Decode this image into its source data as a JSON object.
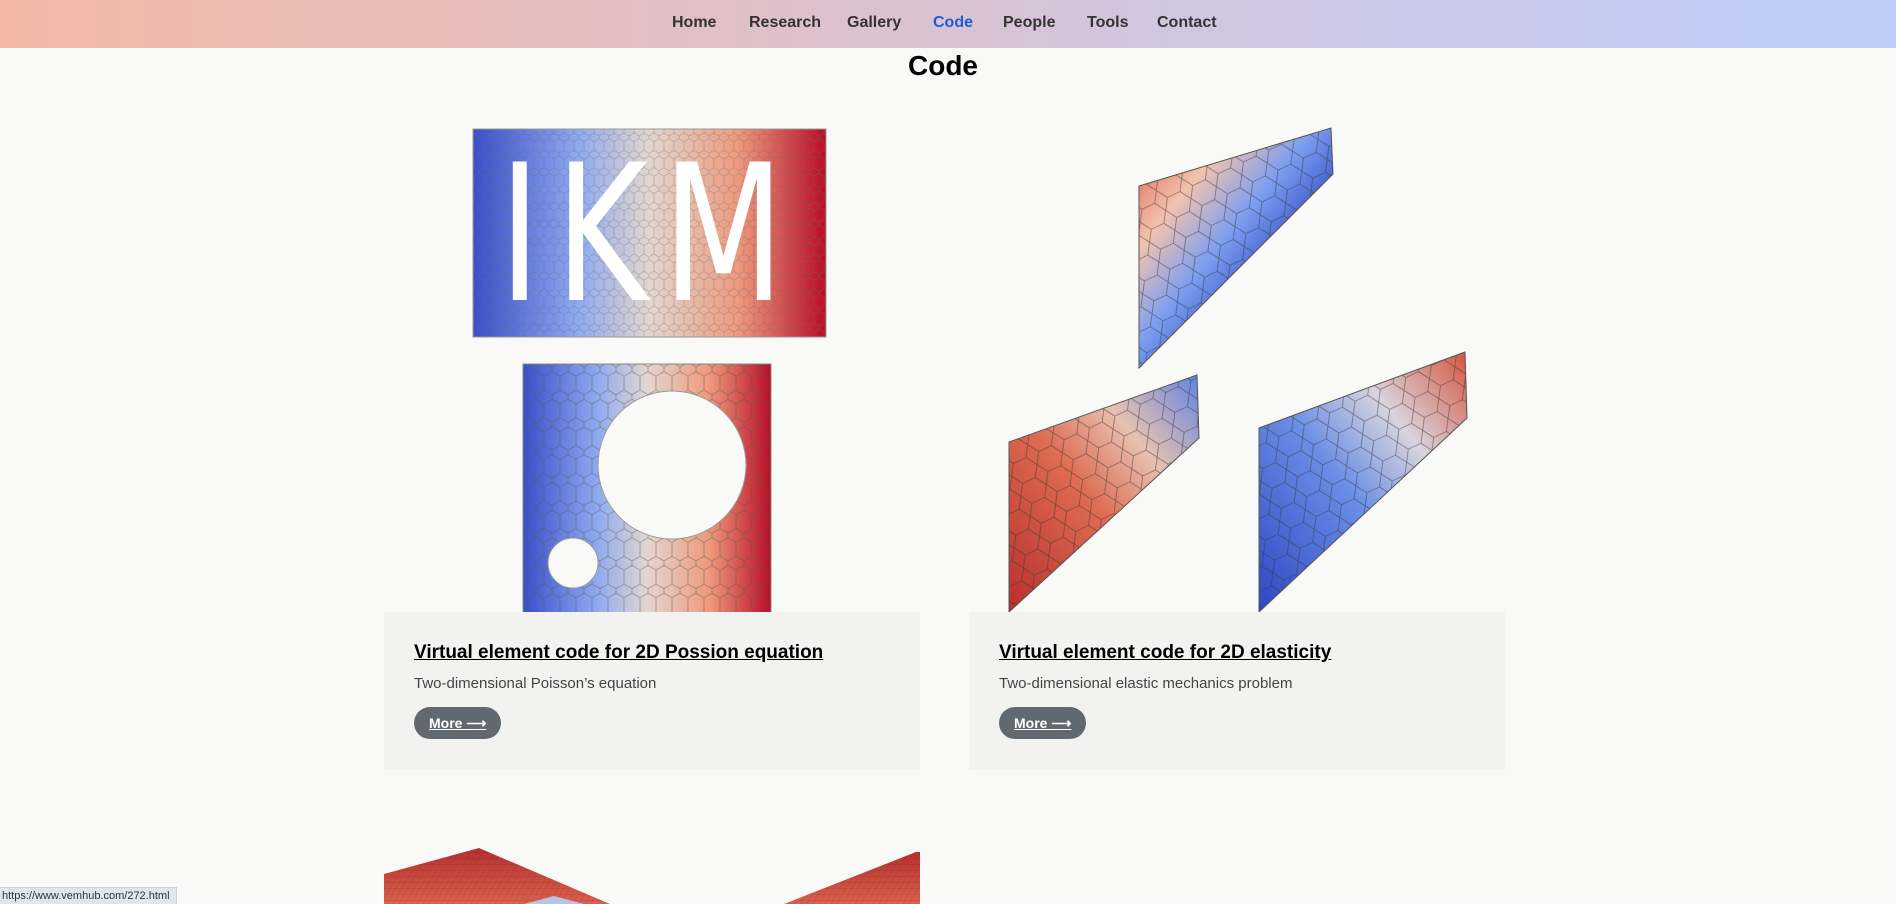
{
  "nav": {
    "items": [
      {
        "label": "Home"
      },
      {
        "label": "Research"
      },
      {
        "label": "Gallery"
      },
      {
        "label": "Code"
      },
      {
        "label": "People"
      },
      {
        "label": "Tools"
      },
      {
        "label": "Contact"
      }
    ],
    "active": "Code"
  },
  "page": {
    "title": "Code"
  },
  "cards": [
    {
      "title": "Virtual element code for 2D Possion equation",
      "description": "Two-dimensional Poisson’s equation",
      "more_label": "More",
      "more_arrow": "⟶",
      "image": {
        "logo_text": "IKM"
      }
    },
    {
      "title": "Virtual element code for 2D elasticity",
      "description": "Two-dimensional elastic mechanics problem",
      "more_label": "More",
      "more_arrow": "⟶"
    }
  ],
  "status_bar": {
    "url": "https://www.vemhub.com/272.html"
  },
  "colors": {
    "accent": "#1a5fd6",
    "button": "#616870",
    "cold": "#3a4fc8",
    "warm": "#b80d26"
  }
}
